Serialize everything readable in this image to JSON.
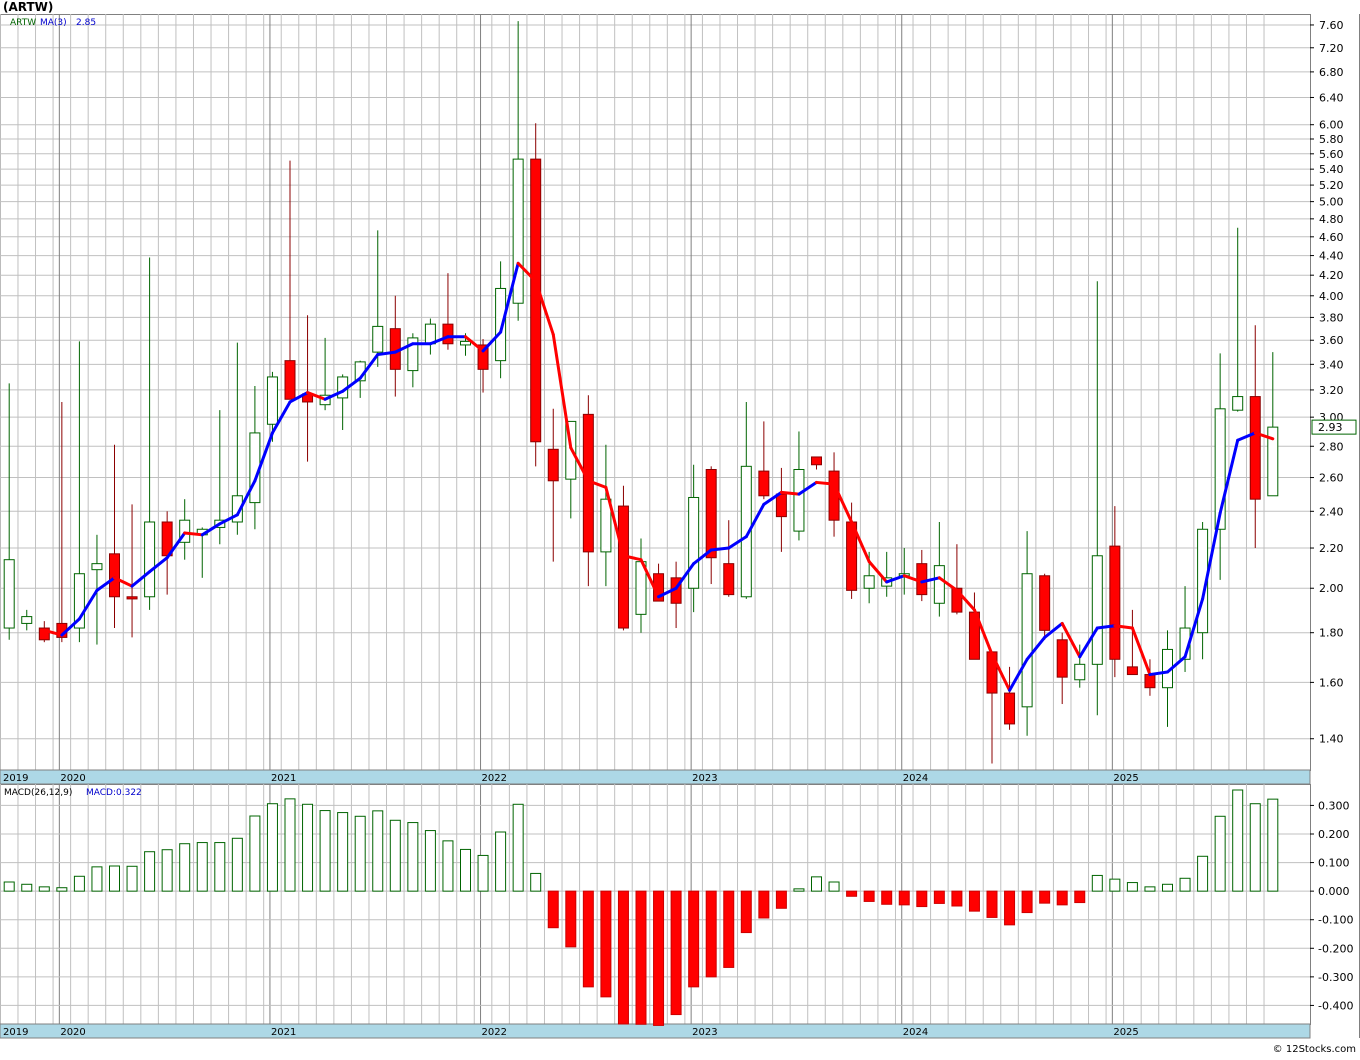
{
  "title": "(ARTW)",
  "legend": {
    "symbol": "ARTW",
    "ma_label": "MA(3)",
    "ma_value": "2.85"
  },
  "macd_legend": {
    "label": "MACD(26,12,9)",
    "value_label": "MACD:0.322"
  },
  "last_price_label": "2.93",
  "watermark": "© 12Stocks.com",
  "colors": {
    "up": "#ffffff",
    "up_stroke": "#006400",
    "down": "#ff0000",
    "down_stroke": "#8b0000",
    "wick_up": "#006400",
    "wick_down": "#8b0000",
    "ma_rising": "#0000ff",
    "ma_falling": "#ff0000",
    "axis_band": "#add8e6",
    "grid": "#c0c0c0",
    "price_label_bg": "#ffffff"
  },
  "chart_data": [
    {
      "type": "candlestick",
      "scale": "log",
      "ylim": [
        1.3,
        7.8
      ],
      "yticks": [
        1.4,
        1.6,
        1.8,
        2.0,
        2.2,
        2.4,
        2.6,
        2.8,
        3.0,
        3.2,
        3.4,
        3.6,
        3.8,
        4.0,
        4.2,
        4.4,
        4.6,
        4.8,
        5.0,
        5.2,
        5.4,
        5.6,
        5.8,
        6.0,
        6.4,
        6.8,
        7.2,
        7.6
      ],
      "ytick_labels": [
        "1.40",
        "1.60",
        "1.80",
        "2.00",
        "2.20",
        "2.40",
        "2.60",
        "2.80",
        "3.00",
        "3.20",
        "3.40",
        "3.60",
        "3.80",
        "4.00",
        "4.20",
        "4.40",
        "4.60",
        "4.80",
        "5.00",
        "5.20",
        "5.40",
        "5.60",
        "5.80",
        "6.00",
        "6.40",
        "6.80",
        "7.20",
        "7.60"
      ],
      "x_year_labels": [
        {
          "label": "2019",
          "index": 0
        },
        {
          "label": "2020",
          "index": 3.3
        },
        {
          "label": "2021",
          "index": 15.3
        },
        {
          "label": "2022",
          "index": 27.3
        },
        {
          "label": "2023",
          "index": 39.3
        },
        {
          "label": "2024",
          "index": 51.3
        },
        {
          "label": "2025",
          "index": 63.3
        }
      ],
      "candles": [
        {
          "o": 1.82,
          "h": 3.25,
          "l": 1.77,
          "c": 2.14
        },
        {
          "o": 1.84,
          "h": 1.9,
          "l": 1.81,
          "c": 1.87
        },
        {
          "o": 1.82,
          "h": 1.85,
          "l": 1.76,
          "c": 1.77
        },
        {
          "o": 1.84,
          "h": 3.11,
          "l": 1.76,
          "c": 1.78
        },
        {
          "o": 1.82,
          "h": 3.59,
          "l": 1.76,
          "c": 2.07
        },
        {
          "o": 2.09,
          "h": 2.27,
          "l": 1.75,
          "c": 2.12
        },
        {
          "o": 2.17,
          "h": 2.81,
          "l": 1.82,
          "c": 1.96
        },
        {
          "o": 1.96,
          "h": 2.44,
          "l": 1.78,
          "c": 1.95
        },
        {
          "o": 1.96,
          "h": 4.38,
          "l": 1.9,
          "c": 2.34
        },
        {
          "o": 2.34,
          "h": 2.4,
          "l": 1.97,
          "c": 2.16
        },
        {
          "o": 2.23,
          "h": 2.47,
          "l": 2.14,
          "c": 2.35
        },
        {
          "o": 2.27,
          "h": 2.31,
          "l": 2.05,
          "c": 2.3
        },
        {
          "o": 2.31,
          "h": 3.05,
          "l": 2.22,
          "c": 2.35
        },
        {
          "o": 2.34,
          "h": 3.58,
          "l": 2.27,
          "c": 2.49
        },
        {
          "o": 2.45,
          "h": 3.23,
          "l": 2.3,
          "c": 2.89
        },
        {
          "o": 2.95,
          "h": 3.34,
          "l": 2.83,
          "c": 3.3
        },
        {
          "o": 3.43,
          "h": 5.51,
          "l": 3.13,
          "c": 3.13
        },
        {
          "o": 3.17,
          "h": 3.82,
          "l": 2.7,
          "c": 3.11
        },
        {
          "o": 3.09,
          "h": 3.62,
          "l": 3.05,
          "c": 3.16
        },
        {
          "o": 3.14,
          "h": 3.32,
          "l": 2.91,
          "c": 3.3
        },
        {
          "o": 3.27,
          "h": 3.43,
          "l": 3.14,
          "c": 3.42
        },
        {
          "o": 3.5,
          "h": 4.67,
          "l": 3.38,
          "c": 3.72
        },
        {
          "o": 3.7,
          "h": 4.0,
          "l": 3.15,
          "c": 3.36
        },
        {
          "o": 3.35,
          "h": 3.66,
          "l": 3.22,
          "c": 3.62
        },
        {
          "o": 3.57,
          "h": 3.79,
          "l": 3.48,
          "c": 3.74
        },
        {
          "o": 3.74,
          "h": 4.22,
          "l": 3.52,
          "c": 3.57
        },
        {
          "o": 3.56,
          "h": 3.66,
          "l": 3.47,
          "c": 3.59
        },
        {
          "o": 3.56,
          "h": 3.61,
          "l": 3.18,
          "c": 3.36
        },
        {
          "o": 3.43,
          "h": 4.34,
          "l": 3.29,
          "c": 4.07
        },
        {
          "o": 3.93,
          "h": 7.67,
          "l": 3.77,
          "c": 5.53
        },
        {
          "o": 5.53,
          "h": 6.02,
          "l": 2.67,
          "c": 2.83
        },
        {
          "o": 2.78,
          "h": 3.06,
          "l": 2.13,
          "c": 2.58
        },
        {
          "o": 2.59,
          "h": 2.94,
          "l": 2.36,
          "c": 2.97
        },
        {
          "o": 3.02,
          "h": 3.16,
          "l": 2.01,
          "c": 2.18
        },
        {
          "o": 2.18,
          "h": 2.81,
          "l": 2.01,
          "c": 2.47
        },
        {
          "o": 2.43,
          "h": 2.55,
          "l": 1.81,
          "c": 1.82
        },
        {
          "o": 1.88,
          "h": 2.25,
          "l": 1.8,
          "c": 2.13
        },
        {
          "o": 2.07,
          "h": 2.12,
          "l": 1.96,
          "c": 1.94
        },
        {
          "o": 2.05,
          "h": 2.13,
          "l": 1.82,
          "c": 1.93
        },
        {
          "o": 2.0,
          "h": 2.68,
          "l": 1.89,
          "c": 2.48
        },
        {
          "o": 2.65,
          "h": 2.67,
          "l": 2.02,
          "c": 2.15
        },
        {
          "o": 2.12,
          "h": 2.35,
          "l": 1.96,
          "c": 1.97
        },
        {
          "o": 1.96,
          "h": 3.11,
          "l": 1.95,
          "c": 2.67
        },
        {
          "o": 2.64,
          "h": 2.97,
          "l": 2.47,
          "c": 2.49
        },
        {
          "o": 2.5,
          "h": 2.66,
          "l": 2.18,
          "c": 2.37
        },
        {
          "o": 2.29,
          "h": 2.9,
          "l": 2.24,
          "c": 2.65
        },
        {
          "o": 2.73,
          "h": 2.73,
          "l": 2.65,
          "c": 2.68
        },
        {
          "o": 2.64,
          "h": 2.76,
          "l": 2.26,
          "c": 2.35
        },
        {
          "o": 2.34,
          "h": 2.45,
          "l": 1.95,
          "c": 1.99
        },
        {
          "o": 2.0,
          "h": 2.18,
          "l": 1.93,
          "c": 2.06
        },
        {
          "o": 2.01,
          "h": 2.18,
          "l": 1.96,
          "c": 2.05
        },
        {
          "o": 2.06,
          "h": 2.2,
          "l": 1.97,
          "c": 2.07
        },
        {
          "o": 2.12,
          "h": 2.19,
          "l": 1.94,
          "c": 1.97
        },
        {
          "o": 1.93,
          "h": 2.34,
          "l": 1.87,
          "c": 2.11
        },
        {
          "o": 2.0,
          "h": 2.22,
          "l": 1.88,
          "c": 1.89
        },
        {
          "o": 1.89,
          "h": 1.98,
          "l": 1.69,
          "c": 1.69
        },
        {
          "o": 1.72,
          "h": 1.72,
          "l": 1.32,
          "c": 1.56
        },
        {
          "o": 1.56,
          "h": 1.66,
          "l": 1.43,
          "c": 1.45
        },
        {
          "o": 1.51,
          "h": 2.29,
          "l": 1.41,
          "c": 2.07
        },
        {
          "o": 2.06,
          "h": 2.07,
          "l": 1.77,
          "c": 1.81
        },
        {
          "o": 1.77,
          "h": 1.8,
          "l": 1.52,
          "c": 1.62
        },
        {
          "o": 1.61,
          "h": 1.75,
          "l": 1.58,
          "c": 1.67
        },
        {
          "o": 1.67,
          "h": 4.14,
          "l": 1.48,
          "c": 2.16
        },
        {
          "o": 2.21,
          "h": 2.43,
          "l": 1.62,
          "c": 1.69
        },
        {
          "o": 1.66,
          "h": 1.9,
          "l": 1.64,
          "c": 1.63
        },
        {
          "o": 1.63,
          "h": 1.69,
          "l": 1.55,
          "c": 1.58
        },
        {
          "o": 1.58,
          "h": 1.81,
          "l": 1.44,
          "c": 1.73
        },
        {
          "o": 1.69,
          "h": 2.01,
          "l": 1.64,
          "c": 1.82
        },
        {
          "o": 1.8,
          "h": 2.34,
          "l": 1.69,
          "c": 2.3
        },
        {
          "o": 2.3,
          "h": 3.49,
          "l": 2.04,
          "c": 3.06
        },
        {
          "o": 3.05,
          "h": 4.7,
          "l": 3.04,
          "c": 3.15
        },
        {
          "o": 3.15,
          "h": 3.73,
          "l": 2.2,
          "c": 2.47
        },
        {
          "o": 2.49,
          "h": 3.5,
          "l": 2.49,
          "c": 2.93
        }
      ],
      "ma3": [
        null,
        null,
        1.81,
        1.79,
        1.86,
        1.99,
        2.05,
        2.01,
        2.08,
        2.15,
        2.28,
        2.27,
        2.33,
        2.38,
        2.58,
        2.89,
        3.11,
        3.18,
        3.13,
        3.19,
        3.29,
        3.48,
        3.5,
        3.57,
        3.57,
        3.63,
        3.63,
        3.51,
        3.67,
        4.32,
        4.14,
        3.65,
        2.79,
        2.58,
        2.54,
        2.16,
        2.14,
        1.96,
        2.0,
        2.12,
        2.19,
        2.2,
        2.26,
        2.44,
        2.51,
        2.5,
        2.57,
        2.56,
        2.34,
        2.13,
        2.03,
        2.06,
        2.03,
        2.05,
        1.99,
        1.9,
        1.71,
        1.57,
        1.69,
        1.78,
        1.84,
        1.7,
        1.82,
        1.83,
        1.82,
        1.63,
        1.64,
        1.7,
        1.95,
        2.39,
        2.84,
        2.89,
        2.85
      ],
      "macd": [
        0.032,
        0.024,
        0.015,
        0.012,
        0.052,
        0.085,
        0.088,
        0.087,
        0.138,
        0.145,
        0.166,
        0.17,
        0.17,
        0.185,
        0.263,
        0.306,
        0.323,
        0.304,
        0.282,
        0.275,
        0.262,
        0.281,
        0.248,
        0.24,
        0.212,
        0.176,
        0.146,
        0.125,
        0.207,
        0.304,
        0.062,
        -0.128,
        -0.195,
        -0.335,
        -0.37,
        -0.465,
        -0.466,
        -0.47,
        -0.432,
        -0.335,
        -0.3,
        -0.267,
        -0.145,
        -0.094,
        -0.06,
        0.008,
        0.05,
        0.032,
        -0.018,
        -0.036,
        -0.046,
        -0.048,
        -0.054,
        -0.043,
        -0.052,
        -0.07,
        -0.092,
        -0.118,
        -0.075,
        -0.042,
        -0.048,
        -0.04,
        0.055,
        0.042,
        0.03,
        0.015,
        0.024,
        0.045,
        0.122,
        0.262,
        0.354,
        0.306,
        0.322
      ],
      "macd_ylim": [
        -0.465,
        0.375
      ],
      "macd_yticks": [
        -0.4,
        -0.3,
        -0.2,
        -0.1,
        0.0,
        0.1,
        0.2,
        0.3
      ],
      "macd_ytick_labels": [
        "-0.400",
        "-0.300",
        "-0.200",
        "-0.100",
        "0.000",
        "0.100",
        "0.200",
        "0.300"
      ]
    }
  ]
}
